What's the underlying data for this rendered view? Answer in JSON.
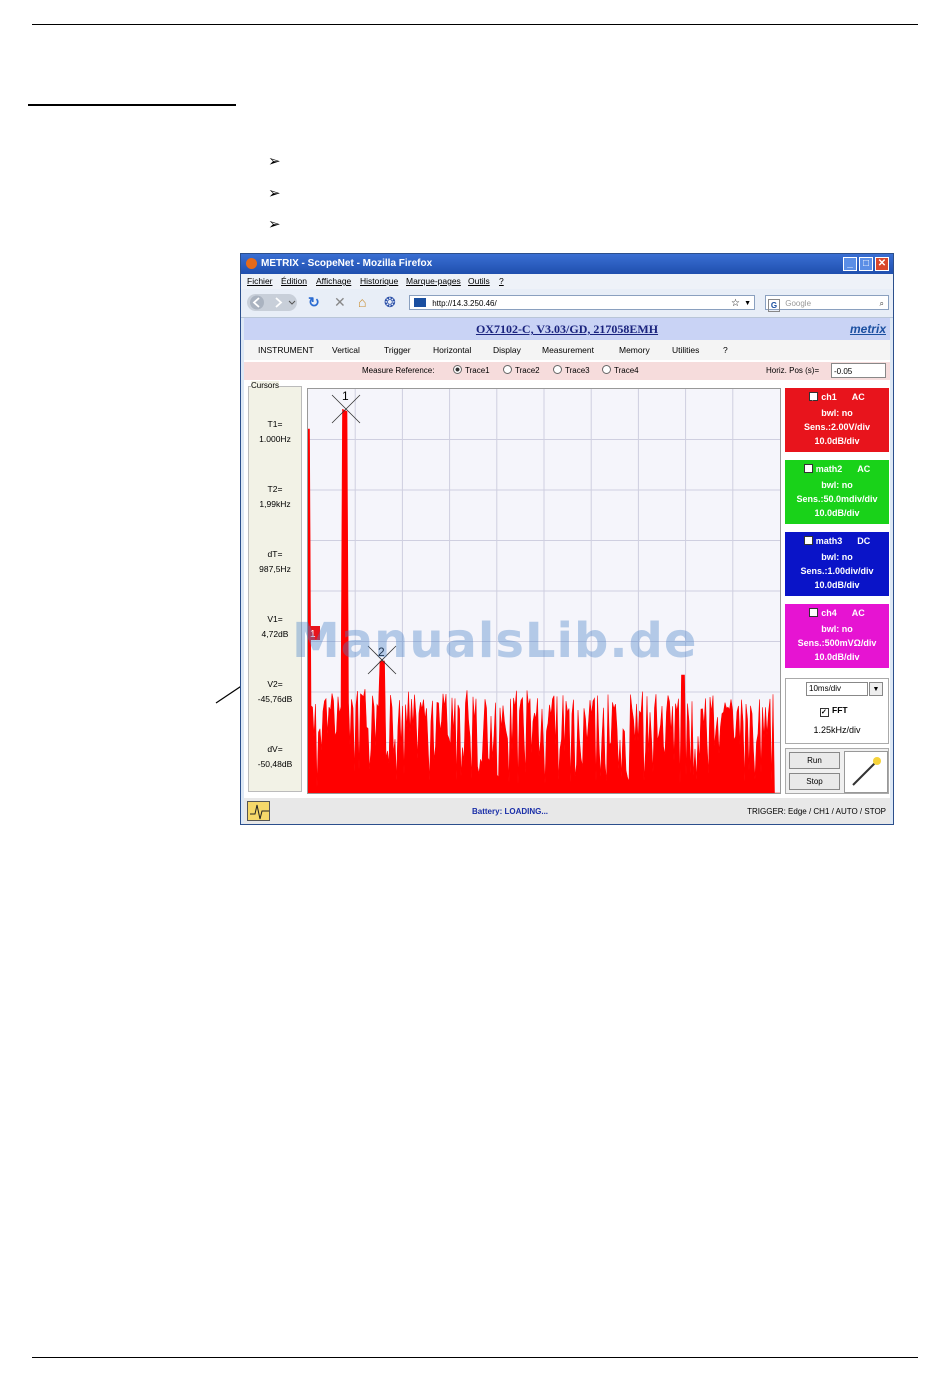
{
  "bullets": [
    "➢",
    "➢",
    "➢"
  ],
  "window": {
    "title": "METRIX - ScopeNet - Mozilla Firefox",
    "minimize": "_",
    "maximize": "□",
    "close": "✕"
  },
  "browser_menu": [
    "Fichier",
    "Édition",
    "Affichage",
    "Historique",
    "Marque-pages",
    "Outils",
    "?"
  ],
  "nav": {
    "back_icon": "back-arrow-icon",
    "forward_icon": "forward-arrow-icon",
    "url": "http://14.3.250.46/",
    "search_placeholder": "Google"
  },
  "app": {
    "title": "OX7102-C, V3.03/GD, 217058EMH",
    "logo": "metrix",
    "menu": [
      "INSTRUMENT",
      "Vertical",
      "Trigger",
      "Horizontal",
      "Display",
      "Measurement",
      "Memory",
      "Utilities",
      "?"
    ],
    "measure_reference_label": "Measure Reference:",
    "traces": [
      "Trace1",
      "Trace2",
      "Trace3",
      "Trace4"
    ],
    "selected_trace": "Trace1",
    "hpos_label": "Horiz. Pos (s)=",
    "hpos_value": "-0.05"
  },
  "cursors": {
    "title": "Cursors",
    "items": [
      {
        "label": "T1=",
        "value": "1.000Hz"
      },
      {
        "label": "T2=",
        "value": "1,99kHz"
      },
      {
        "label": "dT=",
        "value": "987,5Hz"
      },
      {
        "label": "V1=",
        "value": "4,72dB"
      },
      {
        "label": "V2=",
        "value": "-45,76dB"
      },
      {
        "label": "dV=",
        "value": "-50,48dB"
      }
    ]
  },
  "plot": {
    "cursor1_label": "1",
    "cursor2_label": "2",
    "marker_label": "1",
    "trace_color": "#ff0000"
  },
  "channels": [
    {
      "name": "ch1",
      "coupling": "AC",
      "bwl": "bwl: no",
      "sens": "Sens.:2.00V/div",
      "db": "10.0dB/div",
      "color": "#e8141c",
      "checked": true
    },
    {
      "name": "math2",
      "coupling": "AC",
      "bwl": "bwl: no",
      "sens": "Sens.:50.0mdiv/div",
      "db": "10.0dB/div",
      "color": "#19d219",
      "checked": false
    },
    {
      "name": "math3",
      "coupling": "DC",
      "bwl": "bwl: no",
      "sens": "Sens.:1.00div/div",
      "db": "10.0dB/div",
      "color": "#0a14c8",
      "checked": false
    },
    {
      "name": "ch4",
      "coupling": "AC",
      "bwl": "bwl: no",
      "sens": "Sens.:500mVΩ/div",
      "db": "10.0dB/div",
      "color": "#e614d2",
      "checked": false
    }
  ],
  "timebase": {
    "value": "10ms/div",
    "fft_label": "FFT",
    "fft_rate": "1.25kHz/div"
  },
  "run": {
    "run_label": "Run",
    "stop_label": "Stop"
  },
  "status": {
    "battery": "Battery: LOADING...",
    "trigger": "TRIGGER: Edge / CH1 / AUTO / STOP"
  },
  "watermark": "ManualsLib.de"
}
